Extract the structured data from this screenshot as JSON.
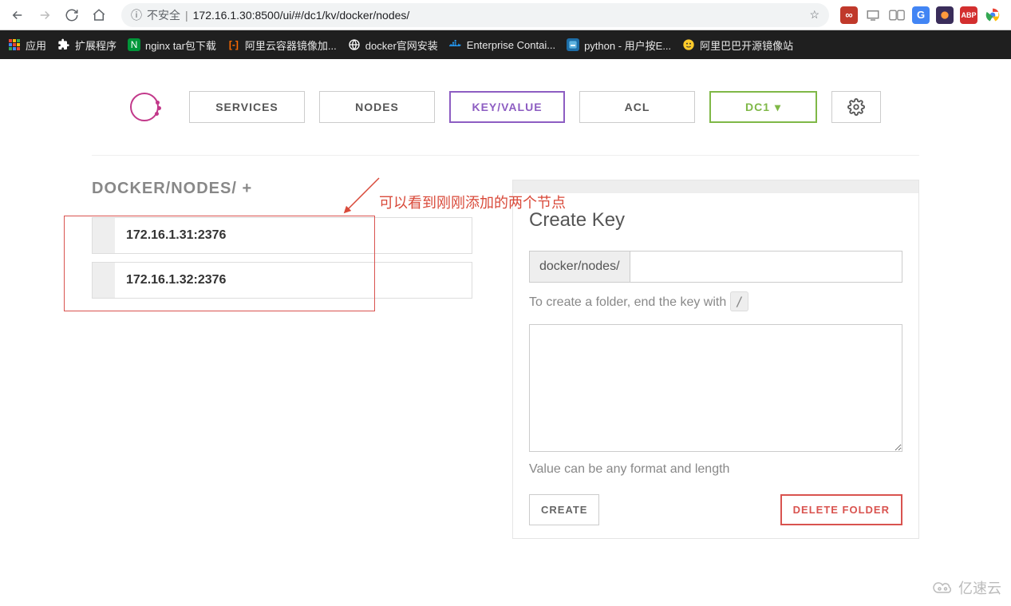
{
  "browser": {
    "security": "不安全",
    "url": "172.16.1.30:8500/ui/#/dc1/kv/docker/nodes/",
    "host": "172.16.1.30",
    "port": ":8500",
    "path": "/ui/#/dc1/kv/docker/nodes/"
  },
  "bookmarks": {
    "apps": "应用",
    "extensions": "扩展程序",
    "nginx": "nginx tar包下载",
    "aliyun": "阿里云容器镜像加...",
    "docker": "docker官网安装",
    "enterprise": "Enterprise Contai...",
    "python": "python - 用户按E...",
    "alibaba": "阿里巴巴开源镜像站"
  },
  "nav": {
    "services": "SERVICES",
    "nodes": "NODES",
    "kv": "KEY/VALUE",
    "acl": "ACL",
    "dc": "DC1"
  },
  "breadcrumb": {
    "path": "DOCKER/NODES/ ",
    "plus": "+"
  },
  "annotation": "可以看到刚刚添加的两个节点",
  "kvitems": [
    {
      "label": "172.16.1.31:2376"
    },
    {
      "label": "172.16.1.32:2376"
    }
  ],
  "panel": {
    "title": "Create Key",
    "prefix": "docker/nodes/",
    "hint_a": "To create a folder, end the key with ",
    "hint_code": "/",
    "hint2": "Value can be any format and length",
    "create": "CREATE",
    "delete": "DELETE FOLDER"
  },
  "watermark": "亿速云"
}
